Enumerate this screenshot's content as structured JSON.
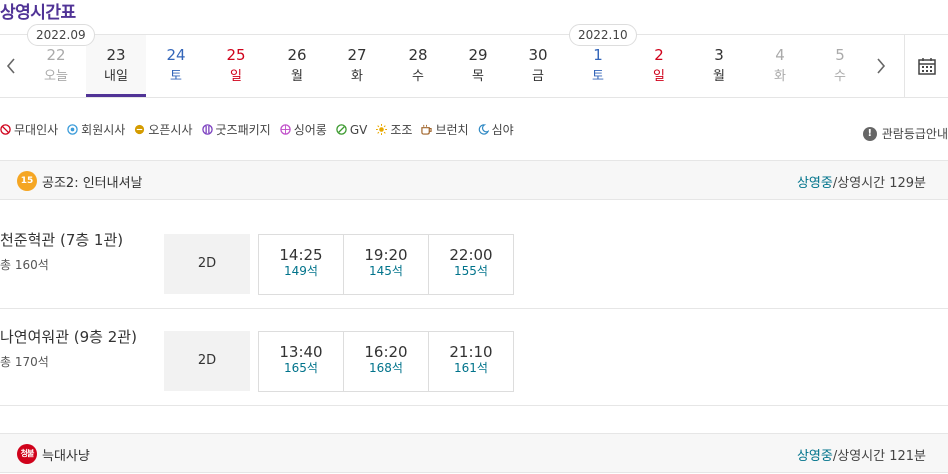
{
  "title": "상영시간표",
  "month_badges": [
    "2022.09",
    "2022.10"
  ],
  "days": [
    {
      "num": "22",
      "wk": "오늘",
      "color": "gray"
    },
    {
      "num": "23",
      "wk": "내일",
      "color": "dark",
      "selected": true
    },
    {
      "num": "24",
      "wk": "토",
      "color": "blue"
    },
    {
      "num": "25",
      "wk": "일",
      "color": "red"
    },
    {
      "num": "26",
      "wk": "월",
      "color": "dark"
    },
    {
      "num": "27",
      "wk": "화",
      "color": "dark"
    },
    {
      "num": "28",
      "wk": "수",
      "color": "dark"
    },
    {
      "num": "29",
      "wk": "목",
      "color": "dark"
    },
    {
      "num": "30",
      "wk": "금",
      "color": "dark"
    },
    {
      "num": "1",
      "wk": "토",
      "color": "blue"
    },
    {
      "num": "2",
      "wk": "일",
      "color": "red"
    },
    {
      "num": "3",
      "wk": "월",
      "color": "dark"
    },
    {
      "num": "4",
      "wk": "화",
      "color": "gray"
    },
    {
      "num": "5",
      "wk": "수",
      "color": "gray"
    }
  ],
  "legend": [
    {
      "icon": "no-entry-icon",
      "label": "무대인사",
      "color": "#d0021b"
    },
    {
      "icon": "member-circle-icon",
      "label": "회원시사",
      "color": "#3a9bd9"
    },
    {
      "icon": "open-circle-icon",
      "label": "오픈시사",
      "color": "#d49b00"
    },
    {
      "icon": "goods-package-icon",
      "label": "굿즈패키지",
      "color": "#7b3fbf"
    },
    {
      "icon": "sing-along-icon",
      "label": "싱어롱",
      "color": "#c04fc9"
    },
    {
      "icon": "gv-icon",
      "label": "GV",
      "color": "#3c9a2f"
    },
    {
      "icon": "sun-icon",
      "label": "조조",
      "color": "#e8a800"
    },
    {
      "icon": "coffee-cup-icon",
      "label": "브런치",
      "color": "#a0642a"
    },
    {
      "icon": "moon-icon",
      "label": "심야",
      "color": "#2f89c4"
    }
  ],
  "rating_guide": "관람등급안내",
  "movies": [
    {
      "age": "15",
      "age_color": "#f5a623",
      "title": "공조2: 인터내셔날",
      "status": "상영중",
      "running": "/상영시간 129분",
      "theaters": [
        {
          "name": "천준혁관 (7층 1관)",
          "seats": "총 160석",
          "format": "2D",
          "times": [
            {
              "time": "14:25",
              "seats": "149석"
            },
            {
              "time": "19:20",
              "seats": "145석"
            },
            {
              "time": "22:00",
              "seats": "155석"
            }
          ]
        },
        {
          "name": "나연여워관 (9층 2관)",
          "seats": "총 170석",
          "format": "2D",
          "times": [
            {
              "time": "13:40",
              "seats": "165석"
            },
            {
              "time": "16:20",
              "seats": "168석"
            },
            {
              "time": "21:10",
              "seats": "161석"
            }
          ]
        }
      ]
    },
    {
      "age": "청불",
      "age_color": "#d0021b",
      "title": "늑대사냥",
      "status": "상영중",
      "running": "/상영시간 121분",
      "theaters": []
    }
  ]
}
